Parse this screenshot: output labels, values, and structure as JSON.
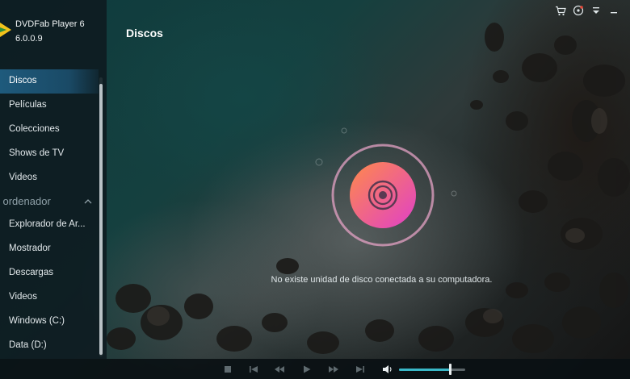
{
  "app": {
    "name": "DVDFab Player 6",
    "version": "6.0.0.9"
  },
  "page": {
    "title": "Discos",
    "empty_message": "No existe unidad de disco conectada a su computadora."
  },
  "sidebar": {
    "library_items": [
      {
        "label": "Discos",
        "active": true
      },
      {
        "label": "Películas",
        "active": false
      },
      {
        "label": "Colecciones",
        "active": false
      },
      {
        "label": "Shows de TV",
        "active": false
      },
      {
        "label": "Videos",
        "active": false
      }
    ],
    "computer_section": {
      "label": "i ordenador",
      "items": [
        {
          "label": "Explorador de Ar..."
        },
        {
          "label": "Mostrador"
        },
        {
          "label": "Descargas"
        },
        {
          "label": "Videos"
        },
        {
          "label": "Windows (C:)"
        },
        {
          "label": "Data (D:)"
        }
      ]
    }
  },
  "top_icons": [
    "cart-icon",
    "update-icon",
    "menu-icon",
    "minimize-icon"
  ],
  "player_controls": [
    "stop-icon",
    "previous-icon",
    "rewind-icon",
    "play-icon",
    "fast-forward-icon",
    "next-icon",
    "volume-icon"
  ],
  "volume": {
    "level": 0.77
  },
  "colors": {
    "accent": "#39b8c8",
    "active_item": "#1e5a7c",
    "disc_gradient_start": "#ff8a4a",
    "disc_gradient_end": "#e040c8"
  }
}
